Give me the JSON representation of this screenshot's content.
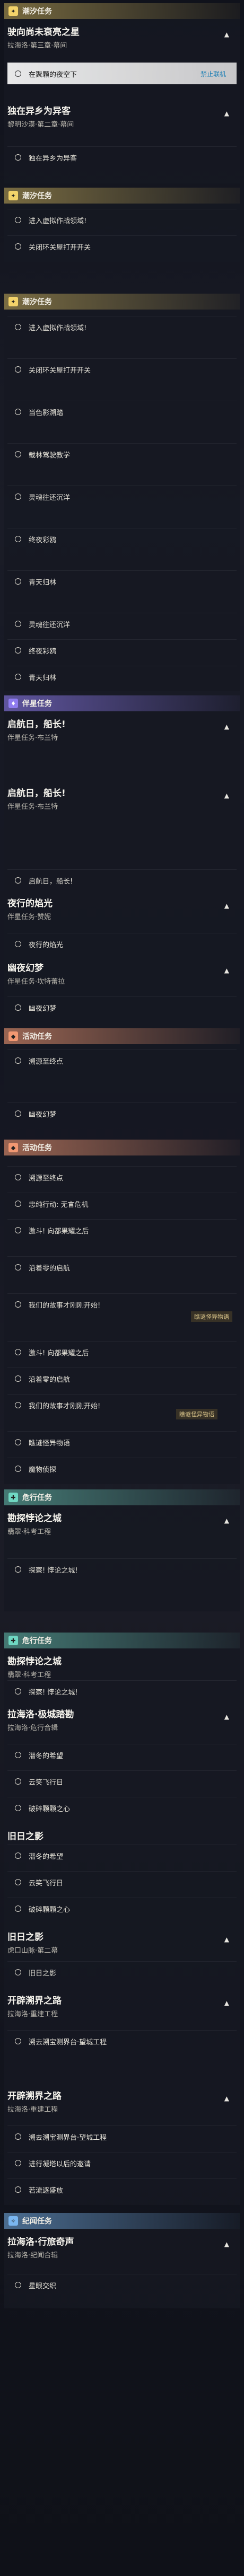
{
  "sections": {
    "s1": "潮汐任务",
    "s2": "潮汐任务",
    "s3": "潮汐任务",
    "s4": "伴星任务",
    "s5": "活动任务",
    "s6": "活动任务",
    "s7": "危行任务",
    "s8": "危行任务",
    "s9": "纪闻任务"
  },
  "quests": {
    "q1": {
      "title": "驶向尚未衰亮之星",
      "sub": "拉海洛·第三章·幕间"
    },
    "q2": {
      "title": "独在异乡为异客",
      "sub": "黎明沙漠·第二章·幕间"
    },
    "q3": {
      "title": "启航日，船长!",
      "sub": "伴星任务·布兰特"
    },
    "q4": {
      "title": "启航日，船长!",
      "sub": "伴星任务·布兰特"
    },
    "q5": {
      "title": "夜行的焰光",
      "sub": "伴星任务·赞妮"
    },
    "q6": {
      "title": "夜行的焰光",
      "sub": "伴星任务·赞妮"
    },
    "q7": {
      "title": "幽夜幻梦",
      "sub": "伴星任务·坎特蕾拉"
    },
    "q8": {
      "title": "勘探悖论之城",
      "sub": "翡翠·科考工程"
    },
    "q9": {
      "title": "勘探悖论之城",
      "sub": "翡翠·科考工程"
    },
    "q10": {
      "title": "拉海洛·极城踏勘",
      "sub": "拉海洛·危行合辑"
    },
    "q11": {
      "title": "旧日之影",
      "sub": "虎口山脉·第二幕"
    },
    "q12": {
      "title": "旧日之影",
      "sub": "虎口山脉·第二幕"
    },
    "q13": {
      "title": "开辟溯界之路",
      "sub": "拉海洛·重建工程"
    },
    "q14": {
      "title": "开辟溯界之路",
      "sub": "拉海洛·重建工程"
    },
    "q15": {
      "title": "拉海洛·行旅奇声",
      "sub": "拉海洛·纪闻合辑"
    }
  },
  "rows": {
    "r1": "在聚颗的夜空下",
    "r2": "独在异乡为异客",
    "r3": "进入虚拟作战领域!",
    "r4": "关闭环关屋打开开关",
    "r5": "进入虚拟作战领域!",
    "r6": "关闭环关屋打开开关",
    "r7": "当色影溯踏",
    "r8": "载林驾驶教学",
    "r9": "灵魂往还沉洋",
    "r10": "终夜彩鸥",
    "r11": "青天归林",
    "r12": "灵魂往还沉洋",
    "r13": "终夜彩鸥",
    "r14": "青天归林",
    "r15": "启航日，船长!",
    "r16": "夜行的焰光",
    "r17": "幽夜幻梦",
    "r18": "溯源至终点",
    "r19": "幽夜幻梦",
    "r20": "溯源至终点",
    "r21": "忠纯行动: 无言危机",
    "r22": "激斗! 向都果耀之后",
    "r23": "沿着零的启航",
    "r24": "我们的故事才刚刚开始!",
    "r25": "激斗! 向都果耀之后",
    "r26": "沿着零的启航",
    "r27": "我们的故事才刚刚开始!",
    "r28": "瞧谜怪异物语",
    "r29": "魔物侦探",
    "r30": "探察! 悖论之城!",
    "r31": "探察! 悖论之城!",
    "r32": "潜冬的希望",
    "r33": "云笑飞行日",
    "r34": "破碎颗颗之心",
    "r35": "潜冬的希望",
    "r36": "云笑飞行日",
    "r37": "破碎颗颗之心",
    "r38": "旧日之影",
    "r39": "溯去溯宝测界台·望城工程",
    "r40": "溯去溯宝测界台·望城工程",
    "r41": "进行凝塔以后的邀请",
    "r42": "若流逐盛放",
    "r43": "星眼交织"
  },
  "misc": {
    "lock": "禁止联机",
    "tag1": "瞧谜怪异物语",
    "tag2": "瞧谜怪异物语",
    "arrow": "▲"
  },
  "colors": {
    "tide": "#f3d36a",
    "companion": "#8f7cf0",
    "event": "#f29872",
    "danger": "#6fd7c2",
    "chronicle": "#7ab6f0"
  }
}
